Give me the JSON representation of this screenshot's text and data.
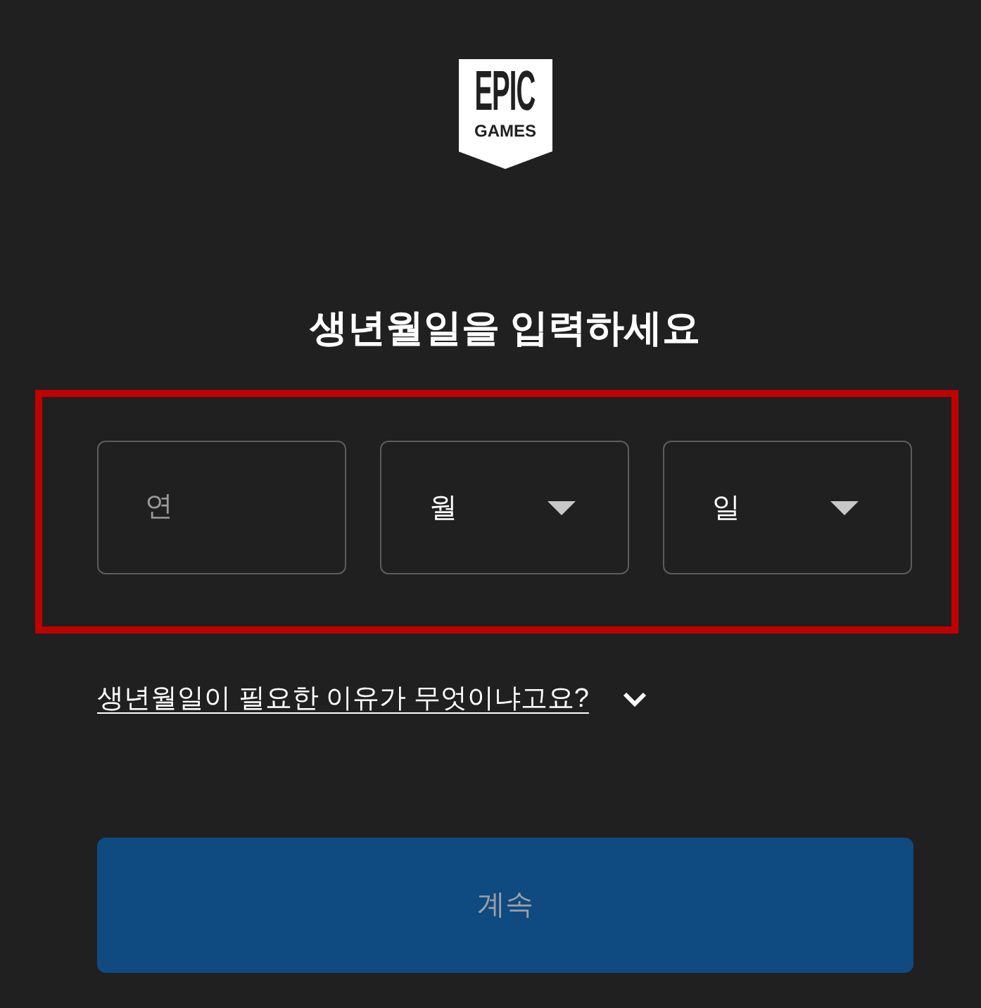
{
  "logo": {
    "lines": [
      "EPIC",
      "GAMES"
    ]
  },
  "heading": "생년월일을 입력하세요",
  "birth_date": {
    "highlighted": true,
    "fields": [
      {
        "kind": "text_input",
        "placeholder": "연"
      },
      {
        "kind": "dropdown",
        "label": "월"
      },
      {
        "kind": "dropdown",
        "label": "일"
      }
    ]
  },
  "why_link": {
    "text": "생년월일이 필요한 이유가 무엇이냐고요?",
    "expanded": false
  },
  "continue_button": {
    "label": "계속",
    "disabled": true
  }
}
